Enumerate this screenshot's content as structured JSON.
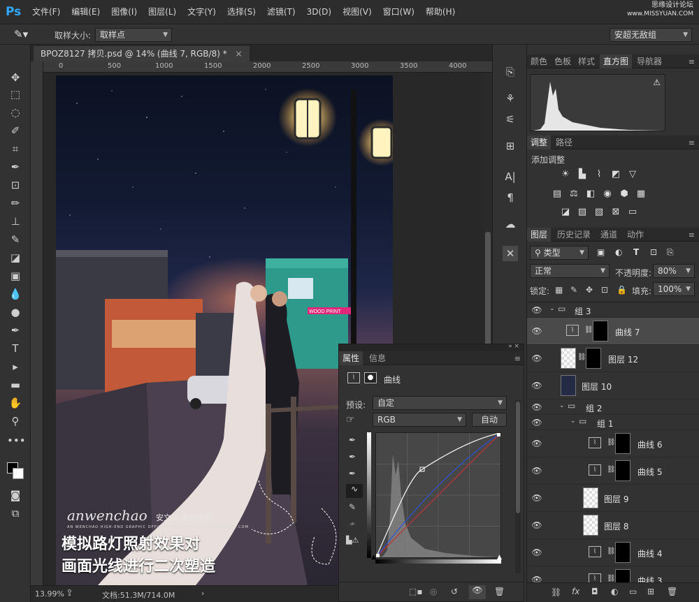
{
  "menubar": {
    "logo": "Ps",
    "items": [
      "文件(F)",
      "编辑(E)",
      "图像(I)",
      "图层(L)",
      "文字(Y)",
      "选择(S)",
      "滤镜(T)",
      "3D(D)",
      "视图(V)",
      "窗口(W)",
      "帮助(H)"
    ],
    "watermark_line1": "思缘设计论坛",
    "watermark_line2": "www.MISSYUAN.COM"
  },
  "options": {
    "sample_size_label": "取样大小:",
    "sample_size_value": "取样点",
    "workspace_value": "安超无敌组"
  },
  "document": {
    "tab_title": "BPOZ8127 拷贝.psd @ 14% (曲线 7, RGB/8) *",
    "close_glyph": "×",
    "ruler_labels": [
      "0",
      "500",
      "1000",
      "1500",
      "2000",
      "2500",
      "3000",
      "3500",
      "4000"
    ],
    "photo_brand": "anwenchao",
    "photo_brand_sub": "安文超 高端修图",
    "photo_brand_tag": "AN WENCHAO HIGH-END GRAPHIC OFFICIAL WEBSITE WWW.ANWENCHAO.COM",
    "shop_sign": "WOOD PRINT",
    "overlay_line1": "模拟路灯照射效果对",
    "overlay_line2": "画面光线进行二次塑造"
  },
  "status": {
    "zoom": "13.99%",
    "doc_info": "文档:51.3M/714.0M"
  },
  "panels": {
    "top_tabs": [
      "颜色",
      "色板",
      "样式",
      "直方图",
      "导航器"
    ],
    "top_active": "直方图",
    "histogram_warning": "⚠",
    "adjust_tabs": [
      "调整",
      "路径"
    ],
    "adjust_title": "添加调整",
    "layer_tabs": [
      "图层",
      "历史记录",
      "通道",
      "动作"
    ],
    "filter_kind": "类型",
    "blend_mode": "正常",
    "opacity_label": "不透明度:",
    "opacity_value": "80%",
    "lock_label": "锁定:",
    "fill_label": "填充:",
    "fill_value": "100%"
  },
  "layers": [
    {
      "name": "组 3",
      "type": "group"
    },
    {
      "name": "曲线 7",
      "type": "curves"
    },
    {
      "name": "图层 12",
      "type": "layer"
    },
    {
      "name": "图层 10",
      "type": "layer"
    },
    {
      "name": "组 2",
      "type": "group"
    },
    {
      "name": "组 1",
      "type": "group"
    },
    {
      "name": "曲线 6",
      "type": "curves"
    },
    {
      "name": "曲线 5",
      "type": "curves"
    },
    {
      "name": "图层 9",
      "type": "layer"
    },
    {
      "name": "图层 8",
      "type": "layer"
    },
    {
      "name": "曲线 4",
      "type": "curves"
    },
    {
      "name": "曲线 3",
      "type": "curves"
    }
  ],
  "properties": {
    "tabs": [
      "属性",
      "信息"
    ],
    "title": "曲线",
    "preset_label": "预设:",
    "preset_value": "自定",
    "channel_value": "RGB",
    "auto_button": "自动"
  },
  "colors": {
    "app_bg": "#282828",
    "panel_bg": "#323232",
    "selected_layer": "#4a4a4a",
    "ps_blue": "#31a8ff"
  }
}
